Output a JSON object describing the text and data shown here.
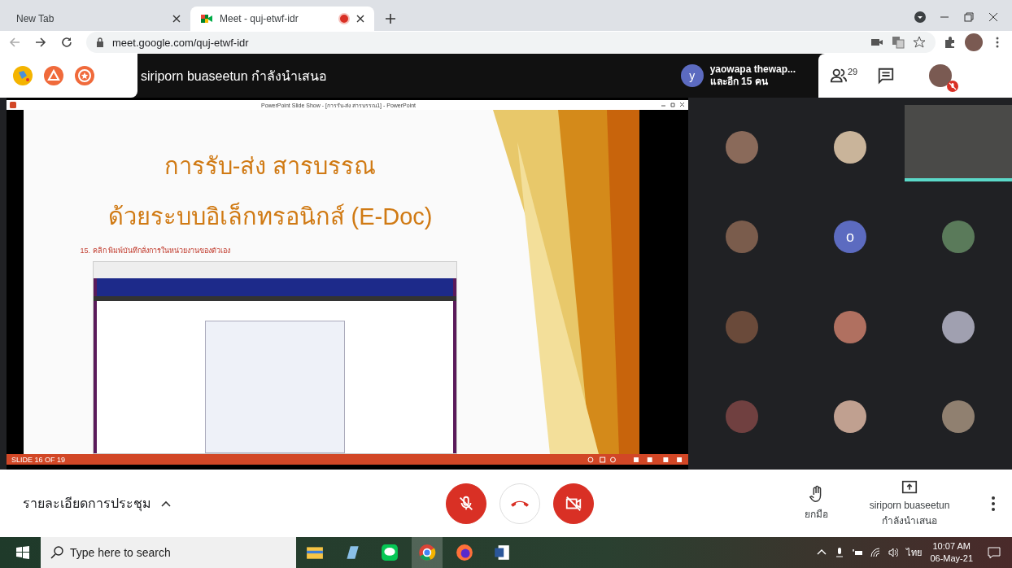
{
  "browser": {
    "tabs": [
      {
        "title": "New Tab",
        "selected": false,
        "recording": false
      },
      {
        "title": "Meet - quj-etwf-idr",
        "selected": true,
        "recording": true
      }
    ],
    "url": "meet.google.com/quj-etwf-idr"
  },
  "meet_header": {
    "presenting_text": "siriporn buaseetun กำลังนำเสนอ",
    "speaker": {
      "initial": "y",
      "name": "yaowapa thewap...",
      "others": "และอีก 15 คน"
    },
    "participant_count": "29",
    "self_muted": true
  },
  "slide_window": {
    "title": "PowerPoint Slide Show - [การรับ-ส่ง สารบรรณ1] - PowerPoint",
    "slide": {
      "title_line_1": "การรับ-ส่ง สารบรรณ",
      "title_line_2": "ด้วยระบบอิเล็กทรอนิกส์ (E-Doc)",
      "step": "15. คลิก พิมพ์บันทึกสั่งการในหน่วยงานของตัวเอง"
    },
    "status": "SLIDE 16 OF 19"
  },
  "participants": [
    {
      "kind": "photo"
    },
    {
      "kind": "photo"
    },
    {
      "kind": "video"
    },
    {
      "kind": "photo"
    },
    {
      "kind": "letter",
      "initial": "o"
    },
    {
      "kind": "photo"
    },
    {
      "kind": "photo"
    },
    {
      "kind": "photo"
    },
    {
      "kind": "photo"
    },
    {
      "kind": "photo"
    },
    {
      "kind": "photo"
    },
    {
      "kind": "photo"
    }
  ],
  "controls": {
    "meeting_details": "รายละเอียดการประชุม",
    "mic_on": false,
    "camera_on": false,
    "raise_hand": "ยกมือ",
    "presenter_name": "siriporn buaseetun",
    "presenter_status": "กำลังนำเสนอ"
  },
  "taskbar": {
    "search_placeholder": "Type here to search",
    "language": "ไทย",
    "time": "10:07 AM",
    "date": "06-May-21"
  }
}
